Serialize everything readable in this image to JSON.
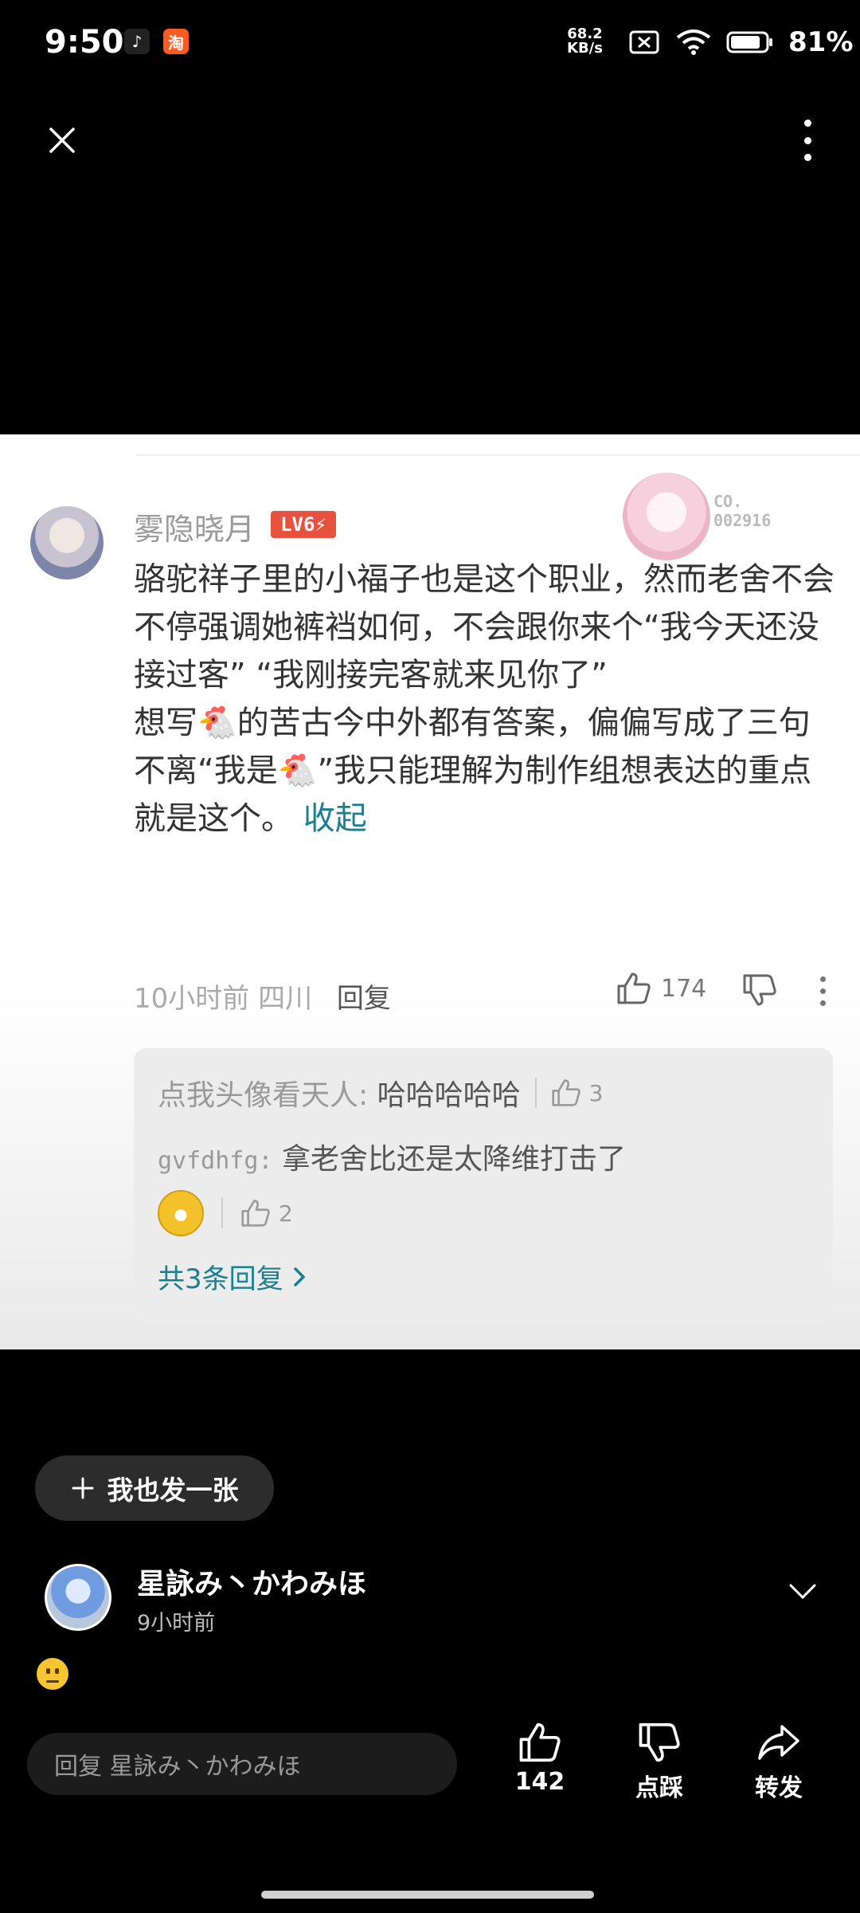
{
  "status_bar": {
    "time": "9:50",
    "tiktok_glyph": "♪",
    "taobao_glyph": "淘",
    "net_speed_value": "68.2",
    "net_speed_unit": "KB/s",
    "battery_pct": "81%",
    "icons": [
      "no-sim-icon",
      "wifi-icon",
      "battery-icon"
    ]
  },
  "comment": {
    "username": "雾隐晓月",
    "level": "LV6⚡",
    "decoration_code": "CO.\n002916",
    "text": "骆驼祥子里的小福子也是这个职业，然而老舍不会不停强调她裤裆如何，不会跟你来个“我今天还没接过客” “我刚接完客就来见你了”\n想写🐔的苦古今中外都有答案，偏偏写成了三句不离“我是🐔”我只能理解为制作组想表达的重点就是这个。",
    "collapse_label": "收起",
    "time_ago": "10小时前",
    "location": "四川",
    "reply_label": "回复",
    "likes": "174"
  },
  "replies": {
    "reply1_user": "点我头像看天人:",
    "reply1_text": "哈哈哈哈哈",
    "reply1_likes": "3",
    "reply2_user": "gvfdhfg:",
    "reply2_text": "拿老舍比还是太降维打击了",
    "reply2_likes": "2",
    "more_label": "共3条回复"
  },
  "post_button": {
    "label": "我也发一张"
  },
  "author": {
    "name": "星詠み丶かわみほ",
    "time": "9小时前"
  },
  "bottom_bar": {
    "input_placeholder": "回复 星詠み丶かわみほ",
    "like_count": "142",
    "dislike_label": "点踩",
    "share_label": "转发"
  }
}
